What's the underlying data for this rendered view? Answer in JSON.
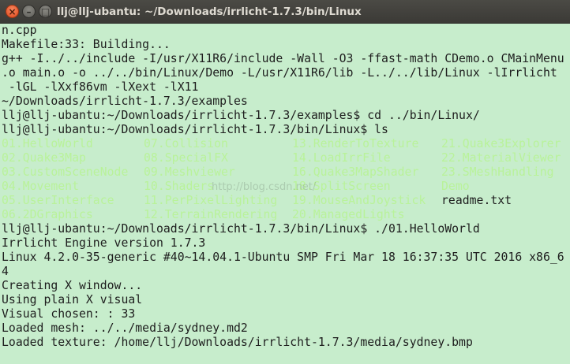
{
  "window": {
    "title": "llj@llj-ubantu: ~/Downloads/irrlicht-1.7.3/bin/Linux",
    "close_glyph": "×",
    "minimize_glyph": "–",
    "maximize_glyph": "□"
  },
  "terminal": {
    "lines_before": [
      "n.cpp",
      "Makefile:33: Building...",
      "g++ -I../../include -I/usr/X11R6/include -Wall -O3 -ffast-math CDemo.o CMainMenu",
      ".o main.o -o ../../bin/Linux/Demo -L/usr/X11R6/lib -L../../lib/Linux -lIrrlicht",
      " -lGL -lXxf86vm -lXext -lX11",
      "~/Downloads/irrlicht-1.7.3/examples",
      "llj@llj-ubantu:~/Downloads/irrlicht-1.7.3/examples$ cd ../bin/Linux/",
      "llj@llj-ubantu:~/Downloads/irrlicht-1.7.3/bin/Linux$ ls"
    ],
    "ls_rows": [
      [
        "01.HelloWorld",
        "07.Collision",
        "13.RenderToTexture",
        "21.Quake3Explorer"
      ],
      [
        "02.Quake3Map",
        "08.SpecialFX",
        "14.LoadIrrFile",
        "22.MaterialViewer"
      ],
      [
        "03.CustomSceneNode",
        "09.Meshviewer",
        "16.Quake3MapShader",
        "23.SMeshHandling"
      ],
      [
        "04.Movement",
        "10.Shaders",
        "18.SplitScreen",
        "Demo"
      ],
      [
        "05.UserInterface",
        "11.PerPixelLighting",
        "19.MouseAndJoystick",
        "readme.txt"
      ],
      [
        "06.2DGraphics",
        "12.TerrainRendering",
        "20.ManagedLights",
        ""
      ]
    ],
    "lines_after": [
      "llj@llj-ubantu:~/Downloads/irrlicht-1.7.3/bin/Linux$ ./01.HelloWorld",
      "Irrlicht Engine version 1.7.3",
      "Linux 4.2.0-35-generic #40~14.04.1-Ubuntu SMP Fri Mar 18 16:37:35 UTC 2016 x86_6",
      "4",
      "Creating X window...",
      "Using plain X visual",
      "Visual chosen: : 33",
      "Loaded mesh: ../../media/sydney.md2",
      "Loaded texture: /home/llj/Downloads/irrlicht-1.7.3/media/sydney.bmp"
    ],
    "watermark": "http://blog.csdn.net/",
    "colors": {
      "background": "#c7edcc",
      "text": "#1e1e1e",
      "executable": "#b9f29a"
    }
  }
}
